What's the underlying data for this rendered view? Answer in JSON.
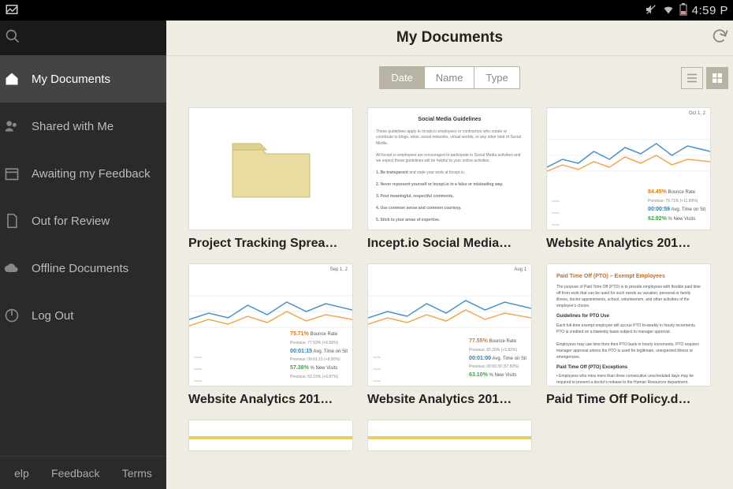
{
  "status": {
    "time": "4:59 P"
  },
  "sidebar": {
    "items": [
      {
        "label": "My Documents",
        "active": true,
        "icon": "home"
      },
      {
        "label": "Shared with Me",
        "active": false,
        "icon": "users"
      },
      {
        "label": "Awaiting my Feedback",
        "active": false,
        "icon": "calendar"
      },
      {
        "label": "Out for Review",
        "active": false,
        "icon": "file"
      },
      {
        "label": "Offline Documents",
        "active": false,
        "icon": "cloud"
      },
      {
        "label": "Log Out",
        "active": false,
        "icon": "logout"
      }
    ],
    "footer": {
      "help": "elp",
      "feedback": "Feedback",
      "terms": "Terms"
    }
  },
  "header": {
    "title": "My Documents"
  },
  "toolbar": {
    "sort": {
      "date": "Date",
      "name": "Name",
      "type": "Type",
      "active": "date"
    }
  },
  "documents": [
    {
      "title": "Project Tracking Sprea…",
      "kind": "folder"
    },
    {
      "title": "Incept.io Social Media…",
      "kind": "textdoc"
    },
    {
      "title": "Website Analytics 201…",
      "kind": "analytics1"
    },
    {
      "title": "Website Analytics 201…",
      "kind": "analytics2"
    },
    {
      "title": "Website Analytics 201…",
      "kind": "analytics3"
    },
    {
      "title": "Paid Time Off Policy.d…",
      "kind": "policy"
    }
  ],
  "thumb_analytics1": {
    "date_hint": "Oct 1, 2",
    "m1": "84.45%",
    "m1l": "Bounce Rate",
    "m1s": "Previous: 79.71% (+11.89%)",
    "m2": "00:00:59",
    "m2l": "Avg. Time on Sit",
    "m2s": "",
    "m3": "62.92%",
    "m3l": "% New Visits",
    "m3s": ""
  },
  "thumb_analytics2": {
    "date_hint": "Sep 1, 2",
    "m1": "75.71%",
    "m1l": "Bounce Rate",
    "m1s": "Previous: 77.53% (+6.58%)",
    "m2": "00:01:15",
    "m2l": "Avg. Time on Sit",
    "m2s": "Previous: 00:01:15 (+8.50%)",
    "m3": "57.38%",
    "m3l": "% New Visits",
    "m3s": "Previous: 63.19% (+6.87%)"
  },
  "thumb_analytics3": {
    "date_hint": "Aug 1",
    "m1": "77.55%",
    "m1l": "Bounce Rate",
    "m1s": "Previous: 83.20% (+5.82%)",
    "m2": "00:01:00",
    "m2l": "Avg. Time on Sit",
    "m2s": "Previous: 00:00:30 (97.82%)",
    "m3": "63.10%",
    "m3l": "% New Visits",
    "m3s": ""
  },
  "thumb_textdoc": {
    "heading": "Social Media Guidelines"
  },
  "thumb_policy": {
    "h1": "Paid Time Off (PTO) – Exempt Employees",
    "h2": "Guidelines for PTO Use",
    "h3": "Paid Time Off (PTO) Exceptions"
  }
}
